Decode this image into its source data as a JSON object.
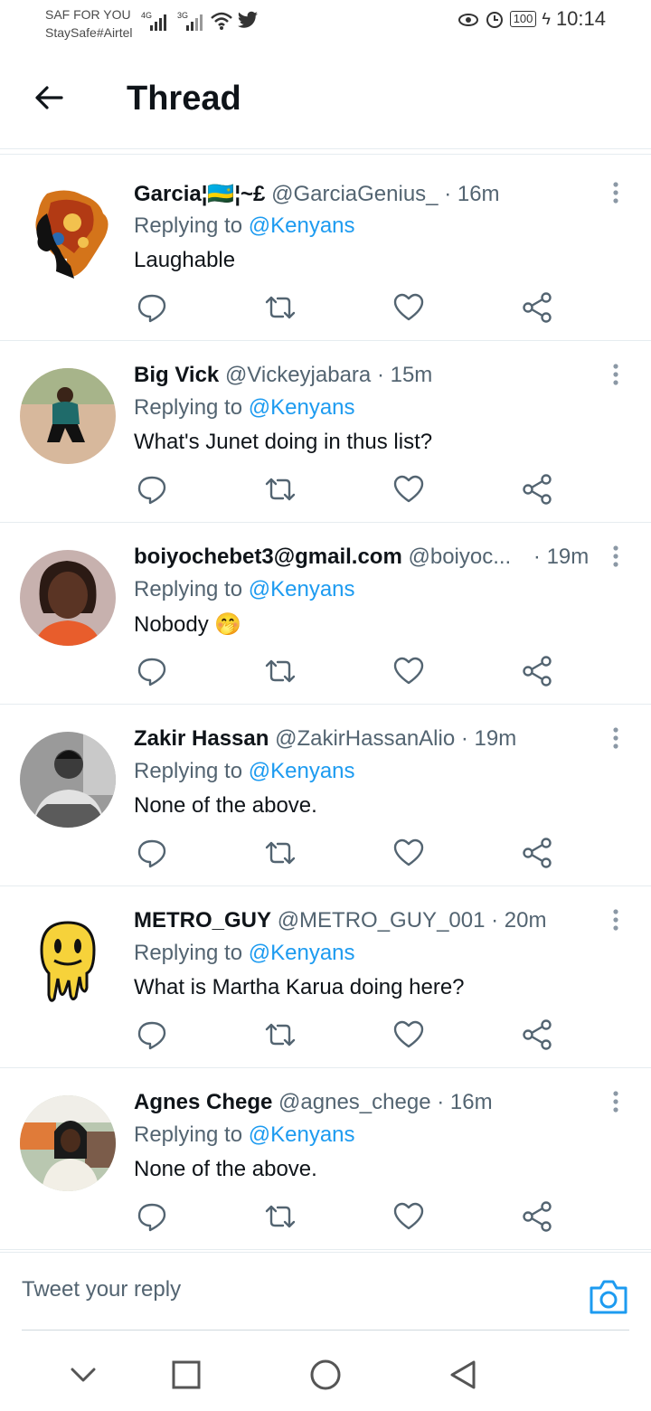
{
  "status_bar": {
    "carrier_line1": "SAF FOR YOU",
    "carrier_line2": "StaySafe#Airtel",
    "net1": "4G",
    "net2": "3G",
    "battery": "100",
    "time": "10:14"
  },
  "header": {
    "title": "Thread"
  },
  "tweets": [
    {
      "name": "Garcia¦🇷🇼¦~£",
      "handle": "@GarciaGenius_",
      "time": "· 16m",
      "reply_prefix": "Replying to",
      "reply_to": "@Kenyans",
      "text": "Laughable"
    },
    {
      "name": "Big Vick",
      "handle": "@Vickeyjabara",
      "time": "· 15m",
      "reply_prefix": "Replying to",
      "reply_to": "@Kenyans",
      "text": "What's Junet doing in thus list?"
    },
    {
      "name": "boiyochebet3@gmail.com",
      "handle": "@boiyoc...",
      "time": "· 19m",
      "reply_prefix": "Replying to",
      "reply_to": "@Kenyans",
      "text": "Nobody 🤭"
    },
    {
      "name": "Zakir Hassan",
      "handle": "@ZakirHassanAlio",
      "time": "· 19m",
      "reply_prefix": "Replying to",
      "reply_to": "@Kenyans",
      "text": "None of the above."
    },
    {
      "name": "METRO_GUY",
      "handle": "@METRO_GUY_001",
      "time": "· 20m",
      "reply_prefix": "Replying to",
      "reply_to": "@Kenyans",
      "text": "What is Martha Karua doing here?"
    },
    {
      "name": "Agnes Chege",
      "handle": "@agnes_chege",
      "time": "· 16m",
      "reply_prefix": "Replying to",
      "reply_to": "@Kenyans",
      "text": "None of the above."
    }
  ],
  "reply_bar": {
    "placeholder": "Tweet your reply"
  },
  "colors": {
    "accent": "#1d9bf0",
    "secondary_text": "#536471",
    "divider": "#e6ecf0"
  }
}
